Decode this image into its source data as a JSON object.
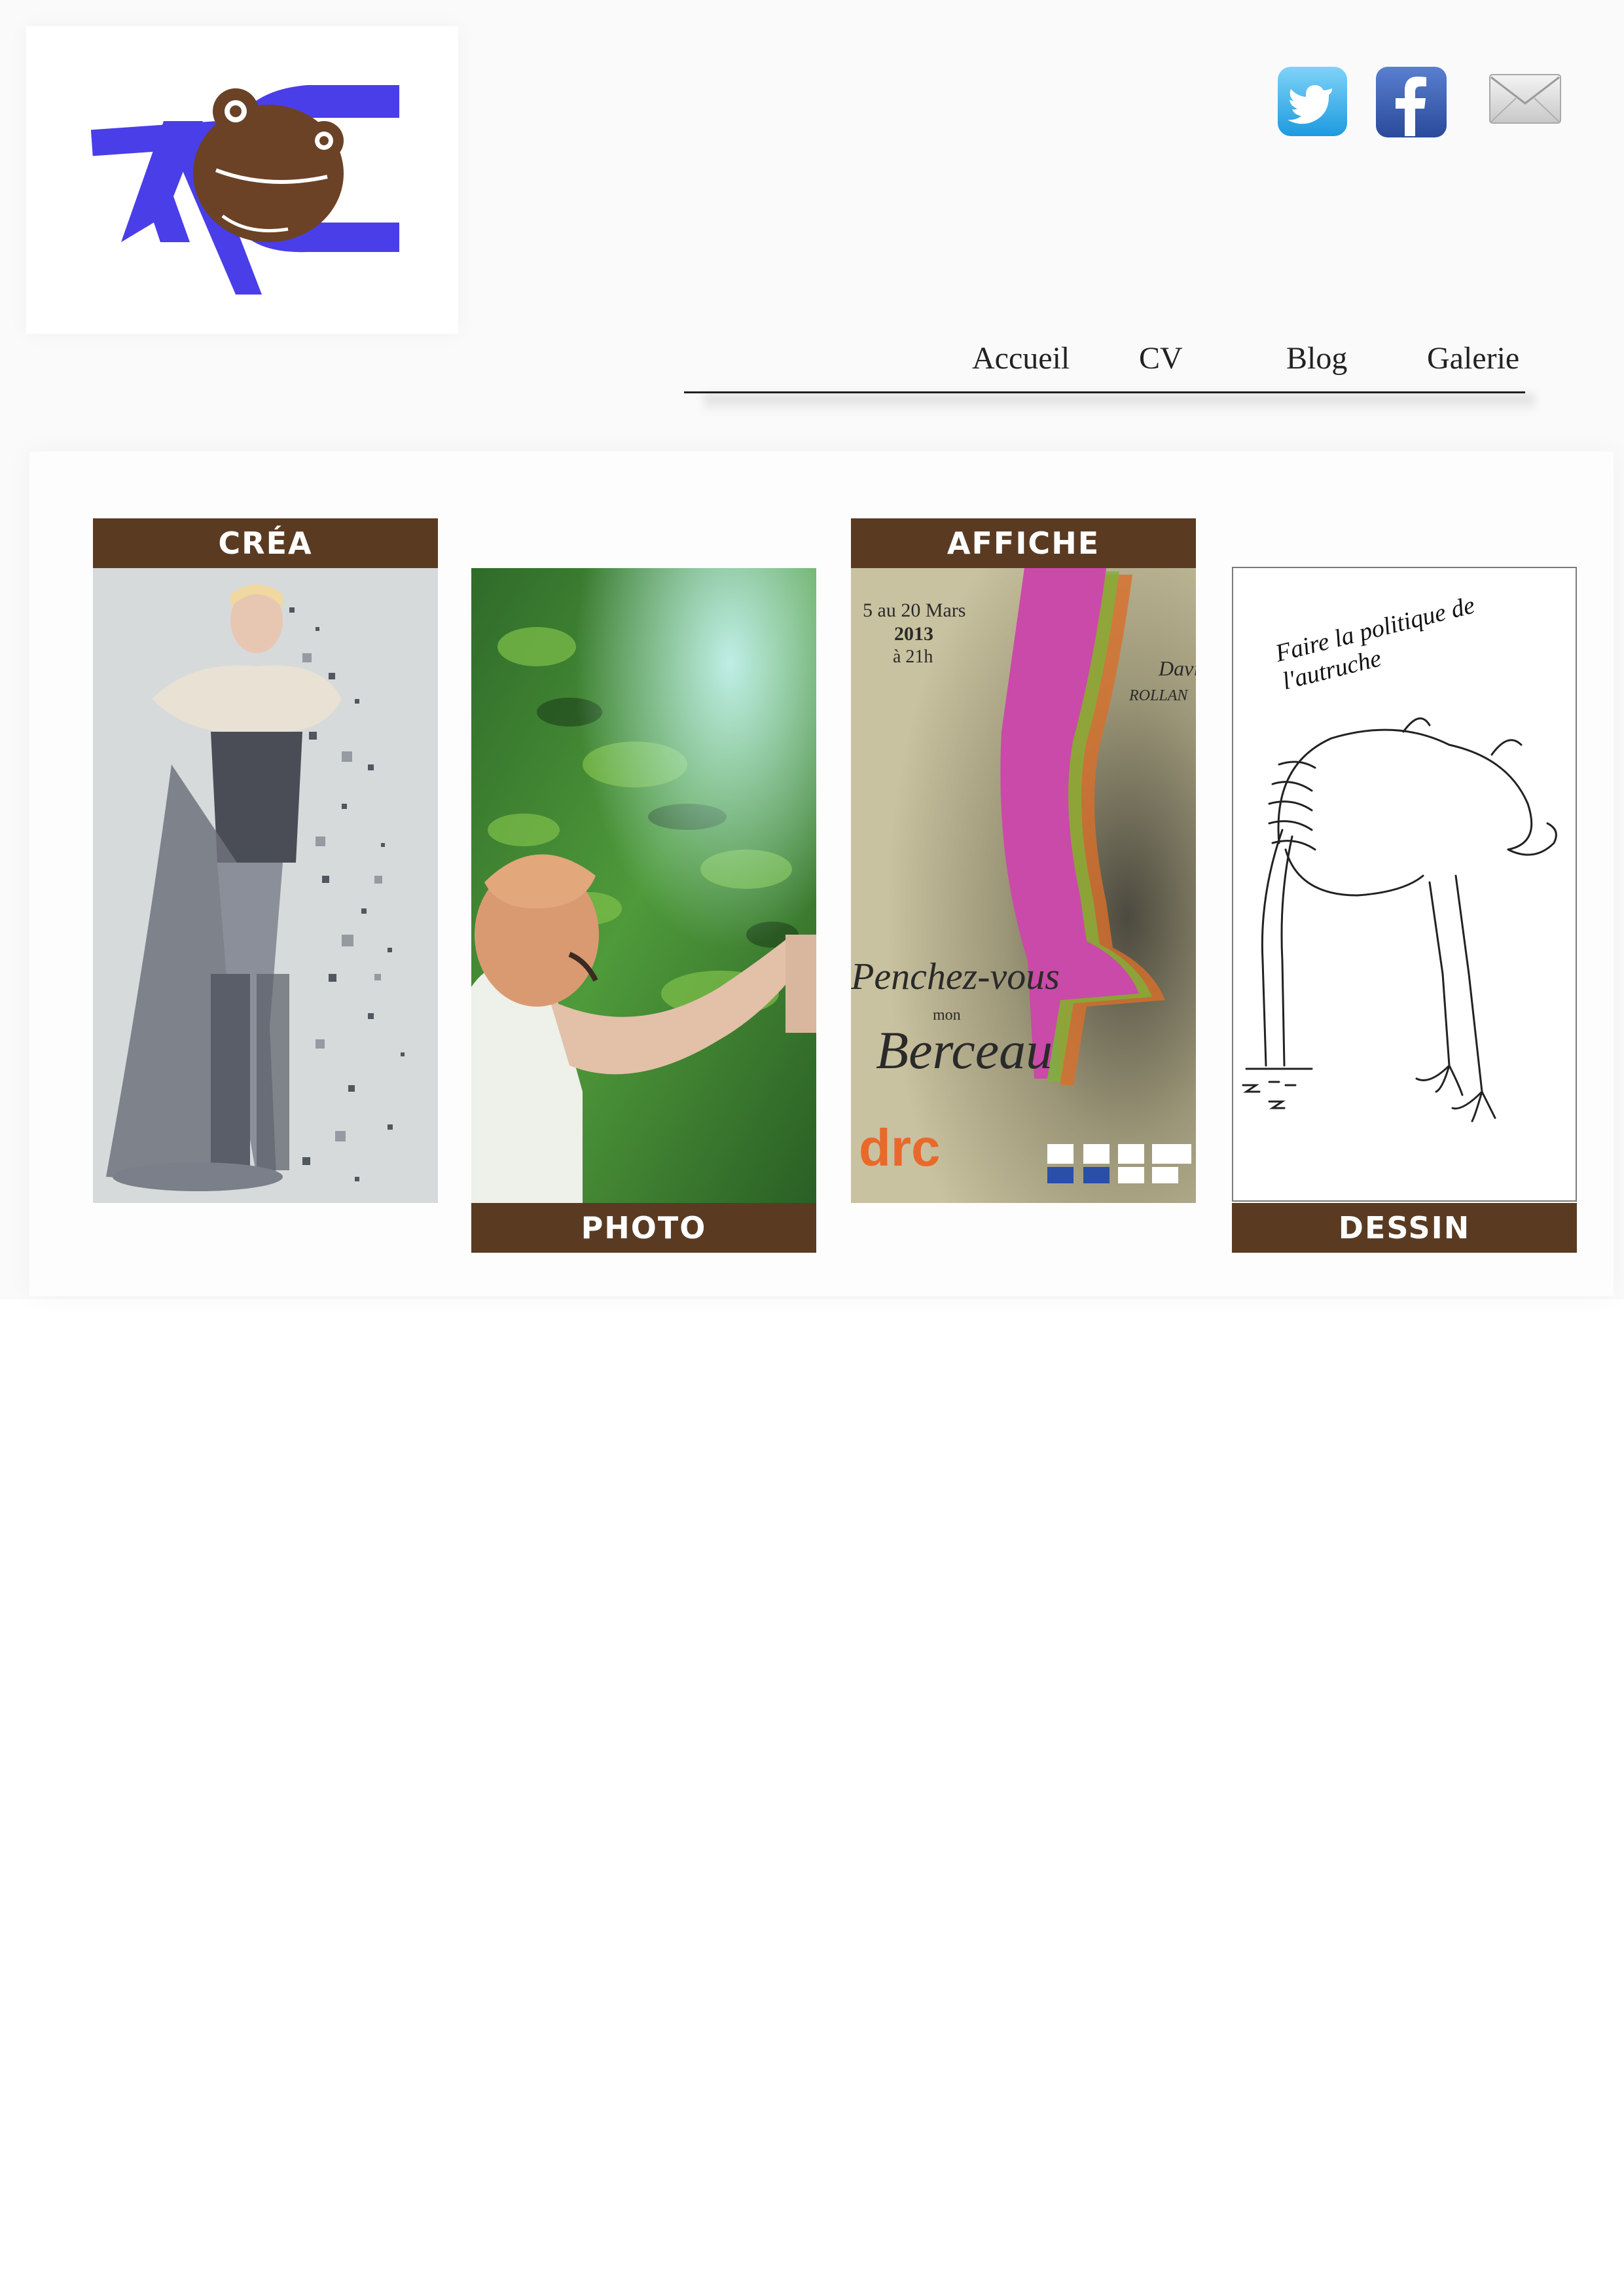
{
  "header": {
    "logo_alt": "AC",
    "social": {
      "twitter_icon": "twitter-icon",
      "facebook_icon": "facebook-icon",
      "mail_icon": "mail-icon"
    }
  },
  "nav": {
    "items": [
      {
        "label": "Accueil"
      },
      {
        "label": "CV"
      },
      {
        "label": "Blog"
      },
      {
        "label": "Galerie"
      }
    ]
  },
  "gallery": {
    "cards": [
      {
        "label": "CRÉA"
      },
      {
        "label": "PHOTO"
      },
      {
        "label": "AFFICHE"
      },
      {
        "label": "DESSIN"
      }
    ],
    "poster": {
      "dates": "5 au 20 Mars",
      "year": "2013",
      "time": "à 21h",
      "artist_first": "Davi",
      "artist_last": "ROLLAN",
      "title_line1": "Penchez-vous",
      "title_mid": "mon",
      "title_line2": "Berceau",
      "brand": "drc"
    },
    "drawing": {
      "caption": "Faire la politique de l'autruche"
    }
  },
  "colors": {
    "brand_brown": "#5a3b22",
    "logo_blue": "#4a3ee8",
    "nav_text": "#222222"
  }
}
